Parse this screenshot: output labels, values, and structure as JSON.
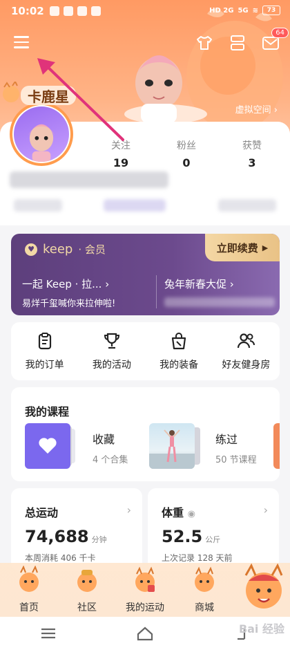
{
  "status_bar": {
    "time": "10:02",
    "battery": "73",
    "network_left": "HD 2G",
    "network_right": "5G"
  },
  "header": {
    "virtual_space": "虚拟空间 ›",
    "notification_count": "64"
  },
  "profile": {
    "tag": "卡鹿星",
    "stats": [
      {
        "label": "关注",
        "value": "19"
      },
      {
        "label": "粉丝",
        "value": "0"
      },
      {
        "label": "获赞",
        "value": "3"
      }
    ]
  },
  "vip": {
    "brand": "keep",
    "brand_suffix": "· 会员",
    "renew": "立即续费",
    "left_title": "一起 Keep · 拉... ›",
    "left_sub": "易烊千玺喊你来拉伸啦!",
    "right_title": "兔年新春大促 ›"
  },
  "quick_actions": [
    {
      "label": "我的订单",
      "icon": "clipboard-icon"
    },
    {
      "label": "我的活动",
      "icon": "trophy-icon"
    },
    {
      "label": "我的装备",
      "icon": "bag-icon"
    },
    {
      "label": "好友健身房",
      "icon": "friends-icon"
    }
  ],
  "courses": {
    "title": "我的课程",
    "items": [
      {
        "title": "收藏",
        "sub": "4 个合集"
      },
      {
        "title": "练过",
        "sub": "50 节课程"
      }
    ]
  },
  "sport_card": {
    "title": "总运动",
    "value": "74,688",
    "unit": "分钟",
    "sub": "本周消耗 406 千卡"
  },
  "weight_card": {
    "title": "体重",
    "value": "52.5",
    "unit": "公斤",
    "sub": "上次记录 128 天前"
  },
  "tabs": [
    "首页",
    "社区",
    "我的运动",
    "商城"
  ],
  "watermark": "Bai 经验",
  "colors": {
    "accent": "#ff9a63",
    "vip": "#5d3f7c",
    "vip_gold": "#f2d9a6",
    "arrow": "#e0337a"
  }
}
